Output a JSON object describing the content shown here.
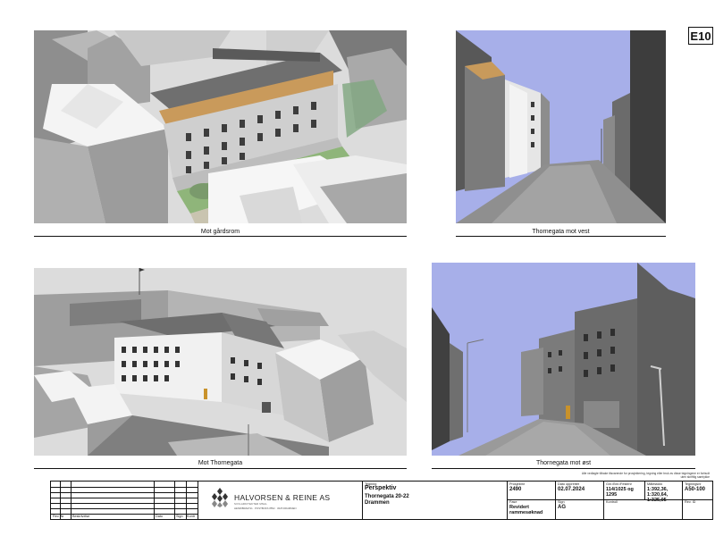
{
  "drawing_id": "E10",
  "views": [
    {
      "caption": "Mot gårdsrom"
    },
    {
      "caption": "Thornegata mot vest"
    },
    {
      "caption": "Mot Thornegata"
    },
    {
      "caption": "Thornegata mot øst"
    }
  ],
  "note": "Alle vedlagte tilbake tilsvarende for prosjektering, tegning eller bruk av disse tegningene er forbudt uten skriftlig samtykke",
  "revision_table": {
    "headers": [
      "Rev. Nr",
      "Beskrivelse",
      "Dato",
      "Sign",
      "Kontr"
    ]
  },
  "company": {
    "name": "HALVORSEN & REINE AS",
    "subtitle": "SIVILARKITEKTER MNAL",
    "address": "HENRIBRAM 91 · POSTBOKS 8552 · 3025 DRAMMEN"
  },
  "title_block": {
    "tegning_label": "Tegning",
    "tegning_value": "Perspektiv",
    "project_value": "Thornegata 20-22\nDrammen",
    "prosjektnr_label": "Prosjektnr",
    "prosjektnr_value": "2490",
    "dato_label": "Dato opprettet",
    "dato_value": "02.07.2024",
    "gnr_label": "Gnr./Bnr./Festenr",
    "gnr_value": "114/1025 og\n1295",
    "malestokk_label": "Målestokk",
    "malestokk_value": "1:392,36,\n1:320,64,\n1:325,05",
    "tegningsnr_label": "Tegningsnr",
    "tegningsnr_value": "A50-100",
    "fase_label": "Fase",
    "fase_value": "Revidert\nrammesøknad",
    "sign_label": "Sign",
    "sign_value": "AG",
    "kontroll_label": "Kontroll",
    "kontroll_value": "",
    "revid_label": "Rev. ID",
    "revid_value": ""
  }
}
